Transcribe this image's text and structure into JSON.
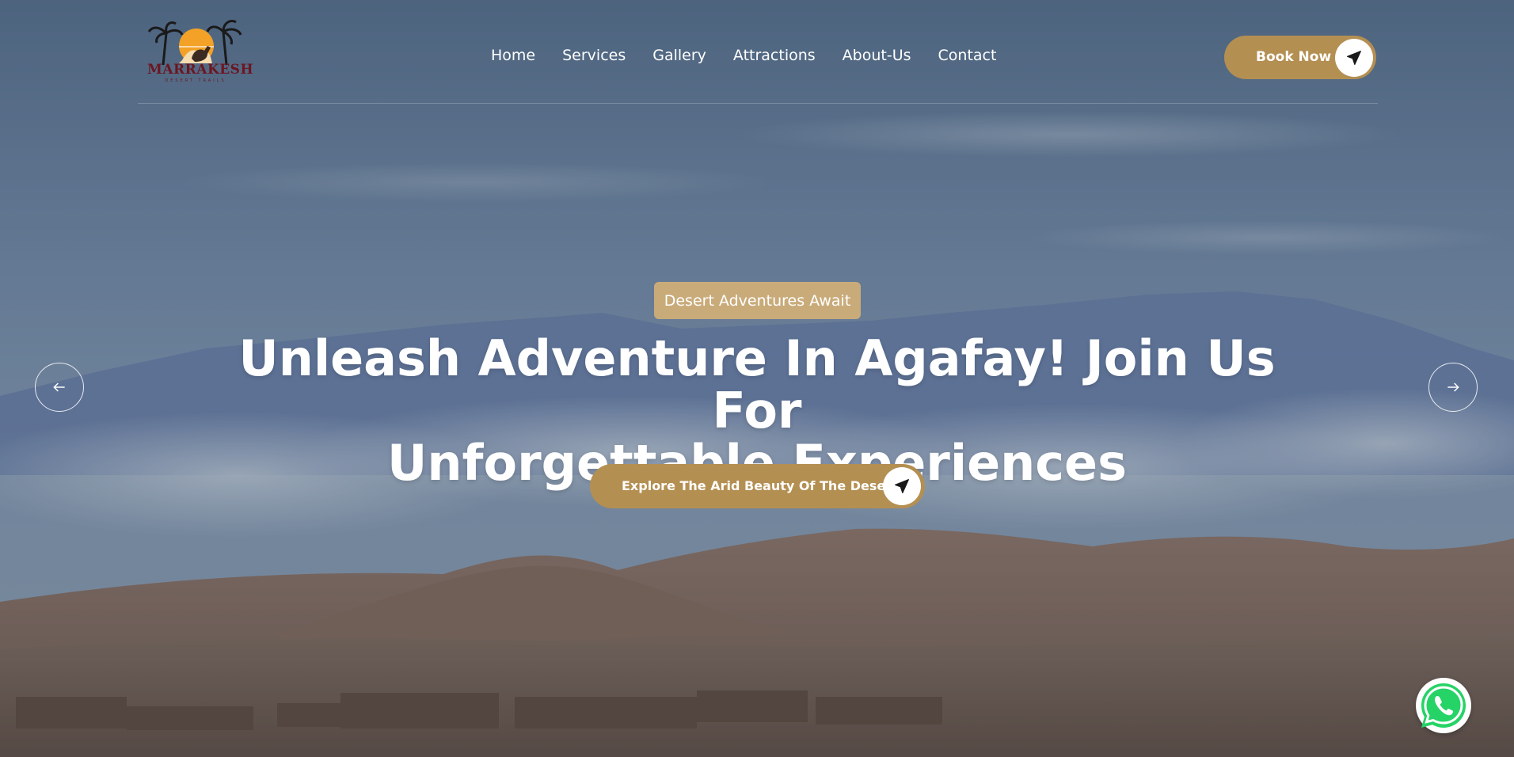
{
  "brand": {
    "name": "MARRAKESH",
    "tagline": "DESERT TRAILS",
    "logo_icon": "palm-sun-camel-logo"
  },
  "nav": {
    "items": [
      {
        "label": "Home"
      },
      {
        "label": "Services"
      },
      {
        "label": "Gallery"
      },
      {
        "label": "Attractions"
      },
      {
        "label": "About-Us"
      },
      {
        "label": "Contact"
      }
    ]
  },
  "header": {
    "book_label": "Book Now",
    "book_icon": "paper-plane-icon"
  },
  "hero": {
    "badge": "Desert Adventures Await",
    "headline_line1": "Unleash Adventure In Agafay! Join Us For",
    "headline_line2": "Unforgettable Experiences",
    "cta_label": "Explore The Arid Beauty Of The Desert",
    "cta_icon": "paper-plane-icon",
    "prev_icon": "arrow-left-icon",
    "next_icon": "arrow-right-icon"
  },
  "floating": {
    "whatsapp_icon": "whatsapp-icon"
  },
  "colors": {
    "accent": "#b48f52",
    "badge": "#c9ab7a",
    "brand_text": "#6b1620",
    "sky_overlay": "#5f7590"
  }
}
